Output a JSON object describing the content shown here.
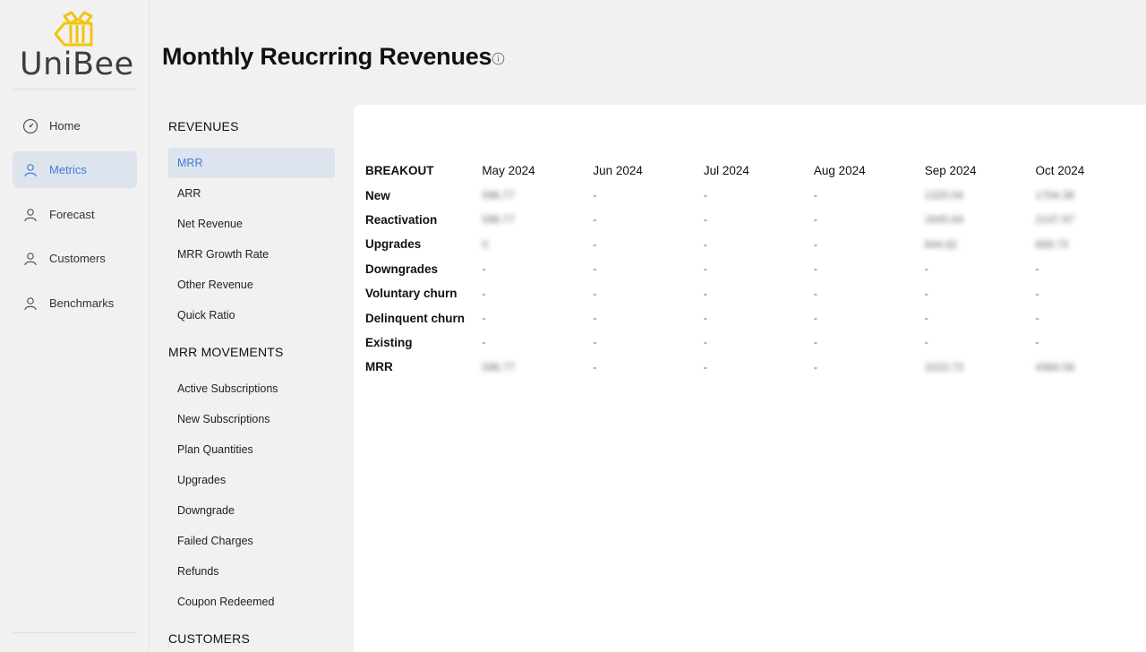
{
  "brand": {
    "name": "UniBee",
    "accent": "#f2c40f"
  },
  "sidebar": {
    "items": [
      {
        "label": "Home",
        "icon": "dashboard-icon"
      },
      {
        "label": "Metrics",
        "icon": "user-icon",
        "active": true
      },
      {
        "label": "Forecast",
        "icon": "user-icon"
      },
      {
        "label": "Customers",
        "icon": "user-icon"
      },
      {
        "label": "Benchmarks",
        "icon": "user-icon"
      }
    ]
  },
  "page": {
    "title": "Monthly Reucrring Revenues",
    "info_icon": "info-icon"
  },
  "submenu": {
    "revenues": {
      "title": "REVENUES",
      "items": [
        "MRR",
        "ARR",
        "Net Revenue",
        "MRR Growth Rate",
        "Other Revenue",
        "Quick Ratio"
      ]
    },
    "movements": {
      "title": "MRR MOVEMENTS",
      "items": [
        "Active Subscriptions",
        "New Subscriptions",
        "Plan Quantities",
        "Upgrades",
        "Downgrade",
        "Failed Charges",
        "Refunds",
        "Coupon Redeemed"
      ]
    },
    "customers": {
      "title": "CUSTOMERS"
    }
  },
  "table": {
    "header": "BREAKOUT",
    "months": [
      "May 2024",
      "Jun 2024",
      "Jul 2024",
      "Aug 2024",
      "Sep 2024",
      "Oct 2024"
    ],
    "rows": [
      {
        "label": "New",
        "values": [
          "596.77",
          "-",
          "-",
          "-",
          "1320.04",
          "1704.38"
        ]
      },
      {
        "label": "Reactivation",
        "values": [
          "596.77",
          "-",
          "-",
          "-",
          "1645.64",
          "2147.97"
        ]
      },
      {
        "label": "Upgrades",
        "values": [
          "0",
          "-",
          "-",
          "-",
          "844.82",
          "669.73"
        ]
      },
      {
        "label": "Downgrades",
        "values": [
          "-",
          "-",
          "-",
          "-",
          "-",
          "-"
        ]
      },
      {
        "label": "Voluntary churn",
        "values": [
          "-",
          "-",
          "-",
          "-",
          "-",
          "-"
        ]
      },
      {
        "label": "Delinquent churn",
        "values": [
          "-",
          "-",
          "-",
          "-",
          "-",
          "-"
        ]
      },
      {
        "label": "Existing",
        "values": [
          "-",
          "-",
          "-",
          "-",
          "-",
          "-"
        ]
      },
      {
        "label": "MRR",
        "values": [
          "596.77",
          "-",
          "-",
          "-",
          "3153.73",
          "4384.58"
        ]
      }
    ]
  }
}
